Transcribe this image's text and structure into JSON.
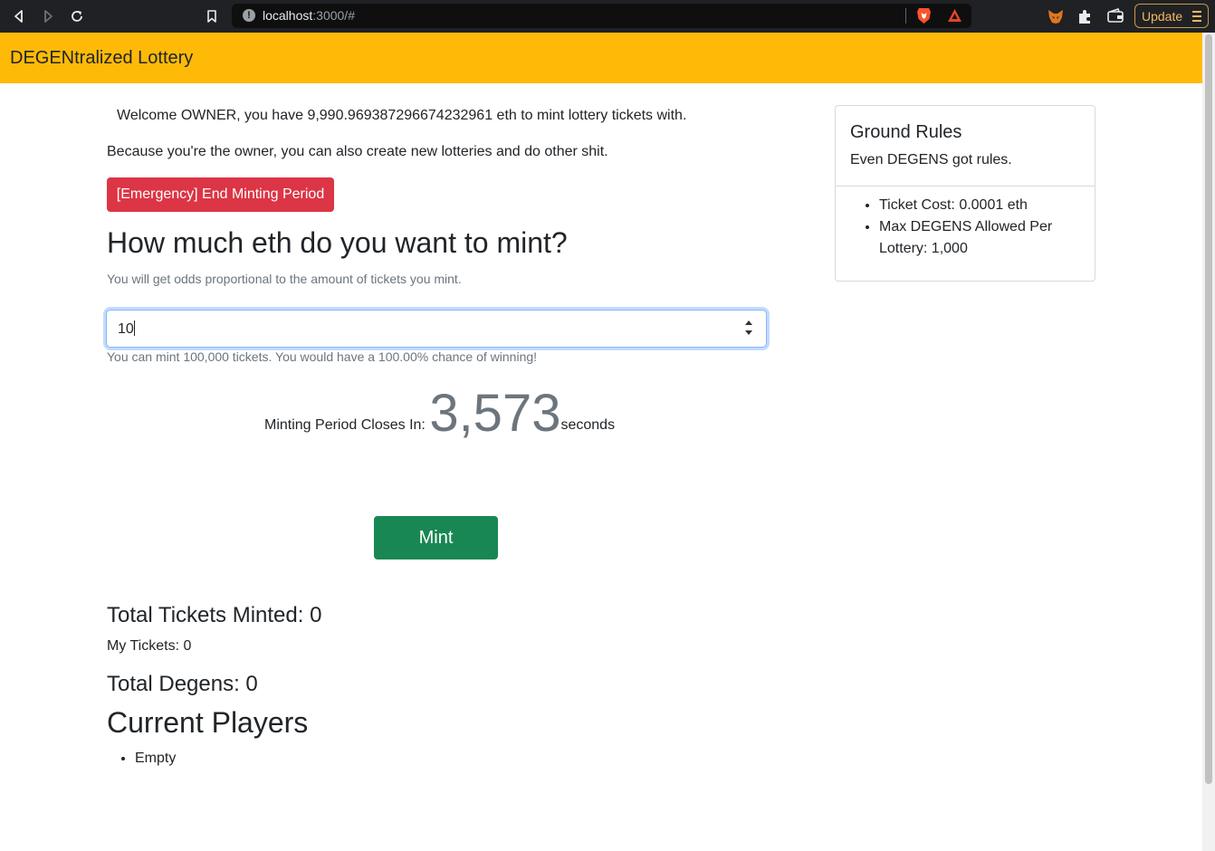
{
  "browser": {
    "url_host": "localhost",
    "url_rest": ":3000/#",
    "update_label": "Update"
  },
  "navbar": {
    "brand": "DEGENtralized Lottery"
  },
  "welcome": {
    "text": "Welcome OWNER, you have 9,990.969387296674232961 eth to mint lottery tickets with.",
    "owner_note": "Because you're the owner, you can also create new lotteries and do other shit."
  },
  "emergency_button": "[Emergency] End Minting Period",
  "mint": {
    "heading": "How much eth do you want to mint?",
    "subtext": "You will get odds proportional to the amount of tickets you mint.",
    "input_value": "10",
    "help_text": "You can mint 100,000 tickets. You would have a 100.00% chance of winning!",
    "button_label": "Mint"
  },
  "countdown": {
    "label": "Minting Period Closes In:",
    "value": "3,573",
    "unit": "seconds"
  },
  "stats": {
    "total_minted": "Total Tickets Minted: 0",
    "my_tickets": "My Tickets: 0",
    "total_degens": "Total Degens: 0"
  },
  "players": {
    "heading": "Current Players",
    "items": [
      "Empty"
    ]
  },
  "rules_card": {
    "title": "Ground Rules",
    "subtitle": "Even DEGENS got rules.",
    "items": [
      "Ticket Cost: 0.0001 eth",
      "Max DEGENS Allowed Per Lottery: 1,000"
    ]
  },
  "colors": {
    "navbar": "#ffba08",
    "danger": "#dc3545",
    "success": "#198754",
    "muted": "#6c757d"
  }
}
